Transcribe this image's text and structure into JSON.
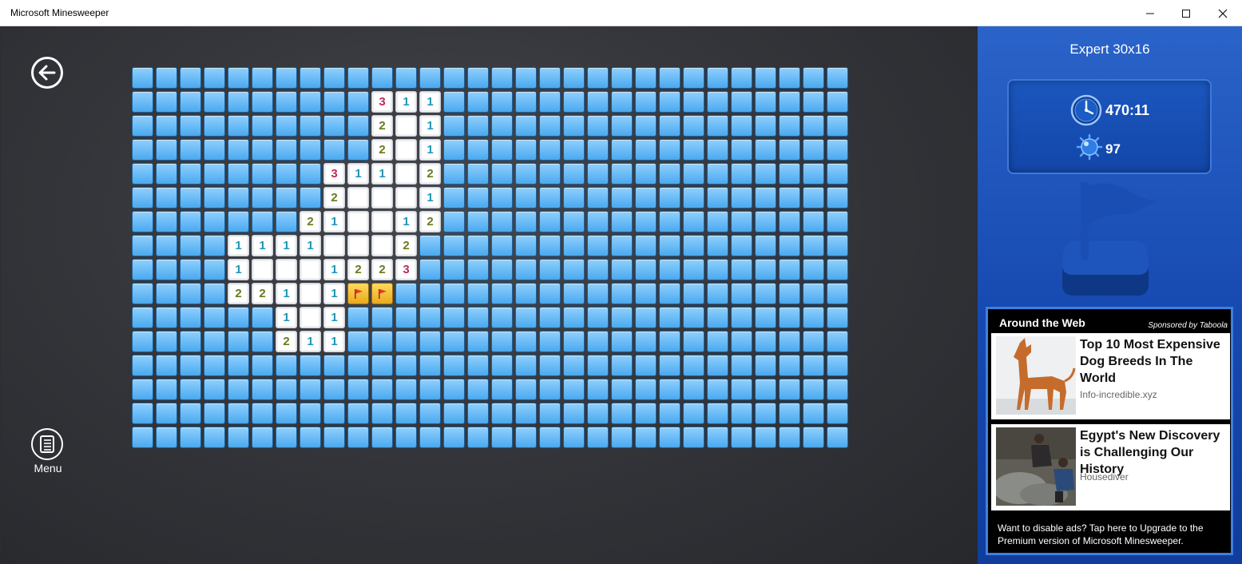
{
  "window": {
    "title": "Microsoft Minesweeper",
    "controls": [
      "minimize",
      "maximize",
      "close"
    ]
  },
  "nav": {
    "back_icon": "back-arrow-icon",
    "menu_icon": "menu-icon",
    "menu_label": "Menu"
  },
  "board": {
    "cols": 30,
    "rows": 16,
    "legend": "rows list revealed cells as [column, value]; value is a number, 'f' for flag, '' for empty revealed; all other cells are hidden",
    "revealed": {
      "1": [
        [
          10,
          "3"
        ],
        [
          11,
          "1"
        ],
        [
          12,
          "1"
        ]
      ],
      "2": [
        [
          10,
          "2"
        ],
        [
          11,
          ""
        ],
        [
          12,
          "1"
        ]
      ],
      "3": [
        [
          10,
          "2"
        ],
        [
          11,
          ""
        ],
        [
          12,
          "1"
        ]
      ],
      "4": [
        [
          8,
          "3"
        ],
        [
          9,
          "1"
        ],
        [
          10,
          "1"
        ],
        [
          11,
          ""
        ],
        [
          12,
          "2"
        ]
      ],
      "5": [
        [
          8,
          "2"
        ],
        [
          9,
          ""
        ],
        [
          10,
          ""
        ],
        [
          11,
          ""
        ],
        [
          12,
          "1"
        ]
      ],
      "6": [
        [
          7,
          "2"
        ],
        [
          8,
          "1"
        ],
        [
          9,
          ""
        ],
        [
          10,
          ""
        ],
        [
          11,
          "1"
        ],
        [
          12,
          "2"
        ]
      ],
      "7": [
        [
          4,
          "1"
        ],
        [
          5,
          "1"
        ],
        [
          6,
          "1"
        ],
        [
          7,
          "1"
        ],
        [
          8,
          ""
        ],
        [
          9,
          ""
        ],
        [
          10,
          ""
        ],
        [
          11,
          "2"
        ]
      ],
      "8": [
        [
          4,
          "1"
        ],
        [
          5,
          ""
        ],
        [
          6,
          ""
        ],
        [
          7,
          ""
        ],
        [
          8,
          "1"
        ],
        [
          9,
          "2"
        ],
        [
          10,
          "2"
        ],
        [
          11,
          "3"
        ]
      ],
      "9": [
        [
          4,
          "2"
        ],
        [
          5,
          "2"
        ],
        [
          6,
          "1"
        ],
        [
          7,
          ""
        ],
        [
          8,
          "1"
        ],
        [
          9,
          "f"
        ],
        [
          10,
          "f"
        ]
      ],
      "10": [
        [
          6,
          "1"
        ],
        [
          7,
          ""
        ],
        [
          8,
          "1"
        ]
      ],
      "11": [
        [
          6,
          "2"
        ],
        [
          7,
          "1"
        ],
        [
          8,
          "1"
        ]
      ]
    }
  },
  "stats": {
    "mode": "Expert 30x16",
    "timer": "470:11",
    "mines_remaining": "97",
    "clock_icon": "clock-icon",
    "mine_icon": "mine-icon",
    "flag_icon": "flag-tool-icon"
  },
  "ad": {
    "header": "Around the Web",
    "sponsor": "Sponsored by Taboola",
    "items": [
      {
        "title": "Top 10 Most Expensive Dog Breeds In The World",
        "source": "Info-incredible.xyz",
        "thumb": "dog-photo"
      },
      {
        "title": "Egypt's New Discovery is Challenging Our History",
        "source": "Housediver",
        "thumb": "excavation-photo"
      }
    ],
    "footer": "Want to disable ads? Tap here to Upgrade to the Premium version of Microsoft Minesweeper."
  },
  "colors": {
    "tile": "#4aa9ee",
    "panel": "#1649b0",
    "num1": "#1f95b8",
    "num2": "#6a7a1c",
    "num3": "#c0285a",
    "flag_tile": "#e9aa1c"
  }
}
